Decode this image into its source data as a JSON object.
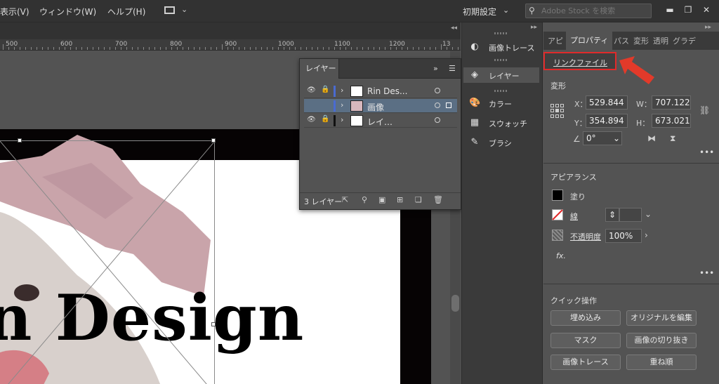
{
  "menubar": {
    "items": [
      "表示(V)",
      "ウィンドウ(W)",
      "ヘルプ(H)"
    ],
    "workspace_preset": "初期設定",
    "stock_search_placeholder": "Adobe Stock を検索"
  },
  "ruler": {
    "labels": [
      "500",
      "600",
      "700",
      "800",
      "900",
      "1000",
      "1100",
      "1200",
      "13"
    ]
  },
  "canvas": {
    "visible_text": "n Design"
  },
  "layers_panel": {
    "tab_label": "レイヤー",
    "more_label": "»",
    "rows": [
      {
        "name": "Rin Des...",
        "color": "#4a6bd1",
        "locked": true,
        "selected": false
      },
      {
        "name": "画像",
        "color": "#4a6bd1",
        "locked": false,
        "selected": true
      },
      {
        "name": "レイ…",
        "color": "#111111",
        "locked": true,
        "selected": false
      }
    ],
    "footer_count": "3 レイヤー"
  },
  "dock": {
    "items": [
      {
        "label": "画像トレース",
        "icon": "image-trace-icon"
      },
      {
        "label": "レイヤー",
        "icon": "layers-icon"
      },
      {
        "label": "カラー",
        "icon": "color-palette-icon"
      },
      {
        "label": "スウォッチ",
        "icon": "swatches-icon"
      },
      {
        "label": "ブラシ",
        "icon": "brush-icon"
      }
    ]
  },
  "properties_panel": {
    "tabs": [
      "アピ",
      "プロパティ",
      "パス",
      "変形",
      "透明",
      "グラデ"
    ],
    "active_tab": "プロパティ",
    "link_file_label": "リンクファイル",
    "transform": {
      "title": "変形",
      "x_label": "X：",
      "x_value": "529.844",
      "y_label": "Y：",
      "y_value": "354.894",
      "w_label": "W：",
      "w_value": "707.122",
      "h_label": "H：",
      "h_value": "673.021",
      "angle_value": "0°"
    },
    "appearance": {
      "title": "アピアランス",
      "fill_label": "塗り",
      "stroke_label": "線",
      "opacity_label": "不透明度",
      "opacity_value": "100%",
      "fx_label": "fx."
    },
    "quick_actions": {
      "title": "クイック操作",
      "buttons": [
        "埋め込み",
        "オリジナルを編集",
        "マスク",
        "画像の切り抜き",
        "画像トレース",
        "重ね順"
      ]
    }
  },
  "colors": {
    "highlight_red": "#e02a2a",
    "selection_row": "#5b6f84"
  }
}
